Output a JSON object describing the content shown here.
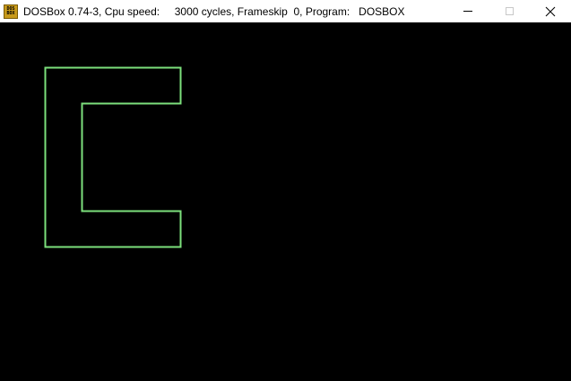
{
  "window": {
    "title": "DOSBox 0.74-3, Cpu speed:     3000 cycles, Frameskip  0, Program:   DOSBOX",
    "icon": "dosbox-icon",
    "icon_text_top": "DOS",
    "icon_text_bottom": "BOX",
    "controls": {
      "minimize": "minimize-icon",
      "maximize": "maximize-icon",
      "close": "close-icon"
    }
  },
  "screen": {
    "background": "#000000",
    "shape_color": "#7CE07C"
  }
}
